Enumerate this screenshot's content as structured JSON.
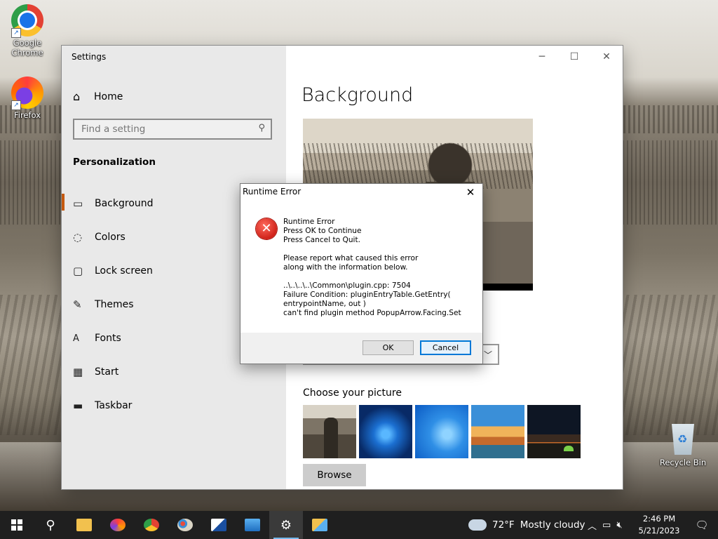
{
  "desktop": {
    "icons": [
      {
        "label": "Google Chrome",
        "icon": "chrome-icon"
      },
      {
        "label": "Firefox",
        "icon": "firefox-icon"
      },
      {
        "label": "Recycle Bin",
        "icon": "recycle-bin-icon"
      }
    ]
  },
  "settings": {
    "window_title": "Settings",
    "home_label": "Home",
    "search_placeholder": "Find a setting",
    "section_label": "Personalization",
    "nav_items": [
      {
        "label": "Background",
        "icon": "picture-icon",
        "active": true
      },
      {
        "label": "Colors",
        "icon": "palette-icon"
      },
      {
        "label": "Lock screen",
        "icon": "lock-screen-icon"
      },
      {
        "label": "Themes",
        "icon": "brush-icon"
      },
      {
        "label": "Fonts",
        "icon": "fonts-icon"
      },
      {
        "label": "Start",
        "icon": "start-icon"
      },
      {
        "label": "Taskbar",
        "icon": "taskbar-icon"
      }
    ],
    "page_title": "Background",
    "choose_picture_label": "Choose your picture",
    "browse_label": "Browse"
  },
  "dialog": {
    "title": "Runtime Error",
    "message": "Runtime Error\nPress OK to Continue\nPress Cancel to Quit.\n\nPlease report what caused this error\nalong with the information below.\n\n..\\..\\..\\..\\Common\\plugin.cpp: 7504\nFailure Condition: pluginEntryTable.GetEntry(\nentrypointName, out )\ncan't find plugin method PopupArrow.Facing.Set",
    "ok_label": "OK",
    "cancel_label": "Cancel"
  },
  "taskbar": {
    "weather_temp": "72°F",
    "weather_text": "Mostly cloudy",
    "time": "2:46 PM",
    "date": "5/21/2023",
    "pinned": [
      "file-explorer-icon",
      "firefox-icon",
      "chrome-icon",
      "paint-icon",
      "app-icon",
      "control-panel-icon",
      "settings-icon",
      "files-icon"
    ]
  },
  "colors": {
    "accent": "#c55a11",
    "focus_blue": "#0078d7",
    "taskbar": "#1f1f1f",
    "error_red": "#d0231a"
  }
}
